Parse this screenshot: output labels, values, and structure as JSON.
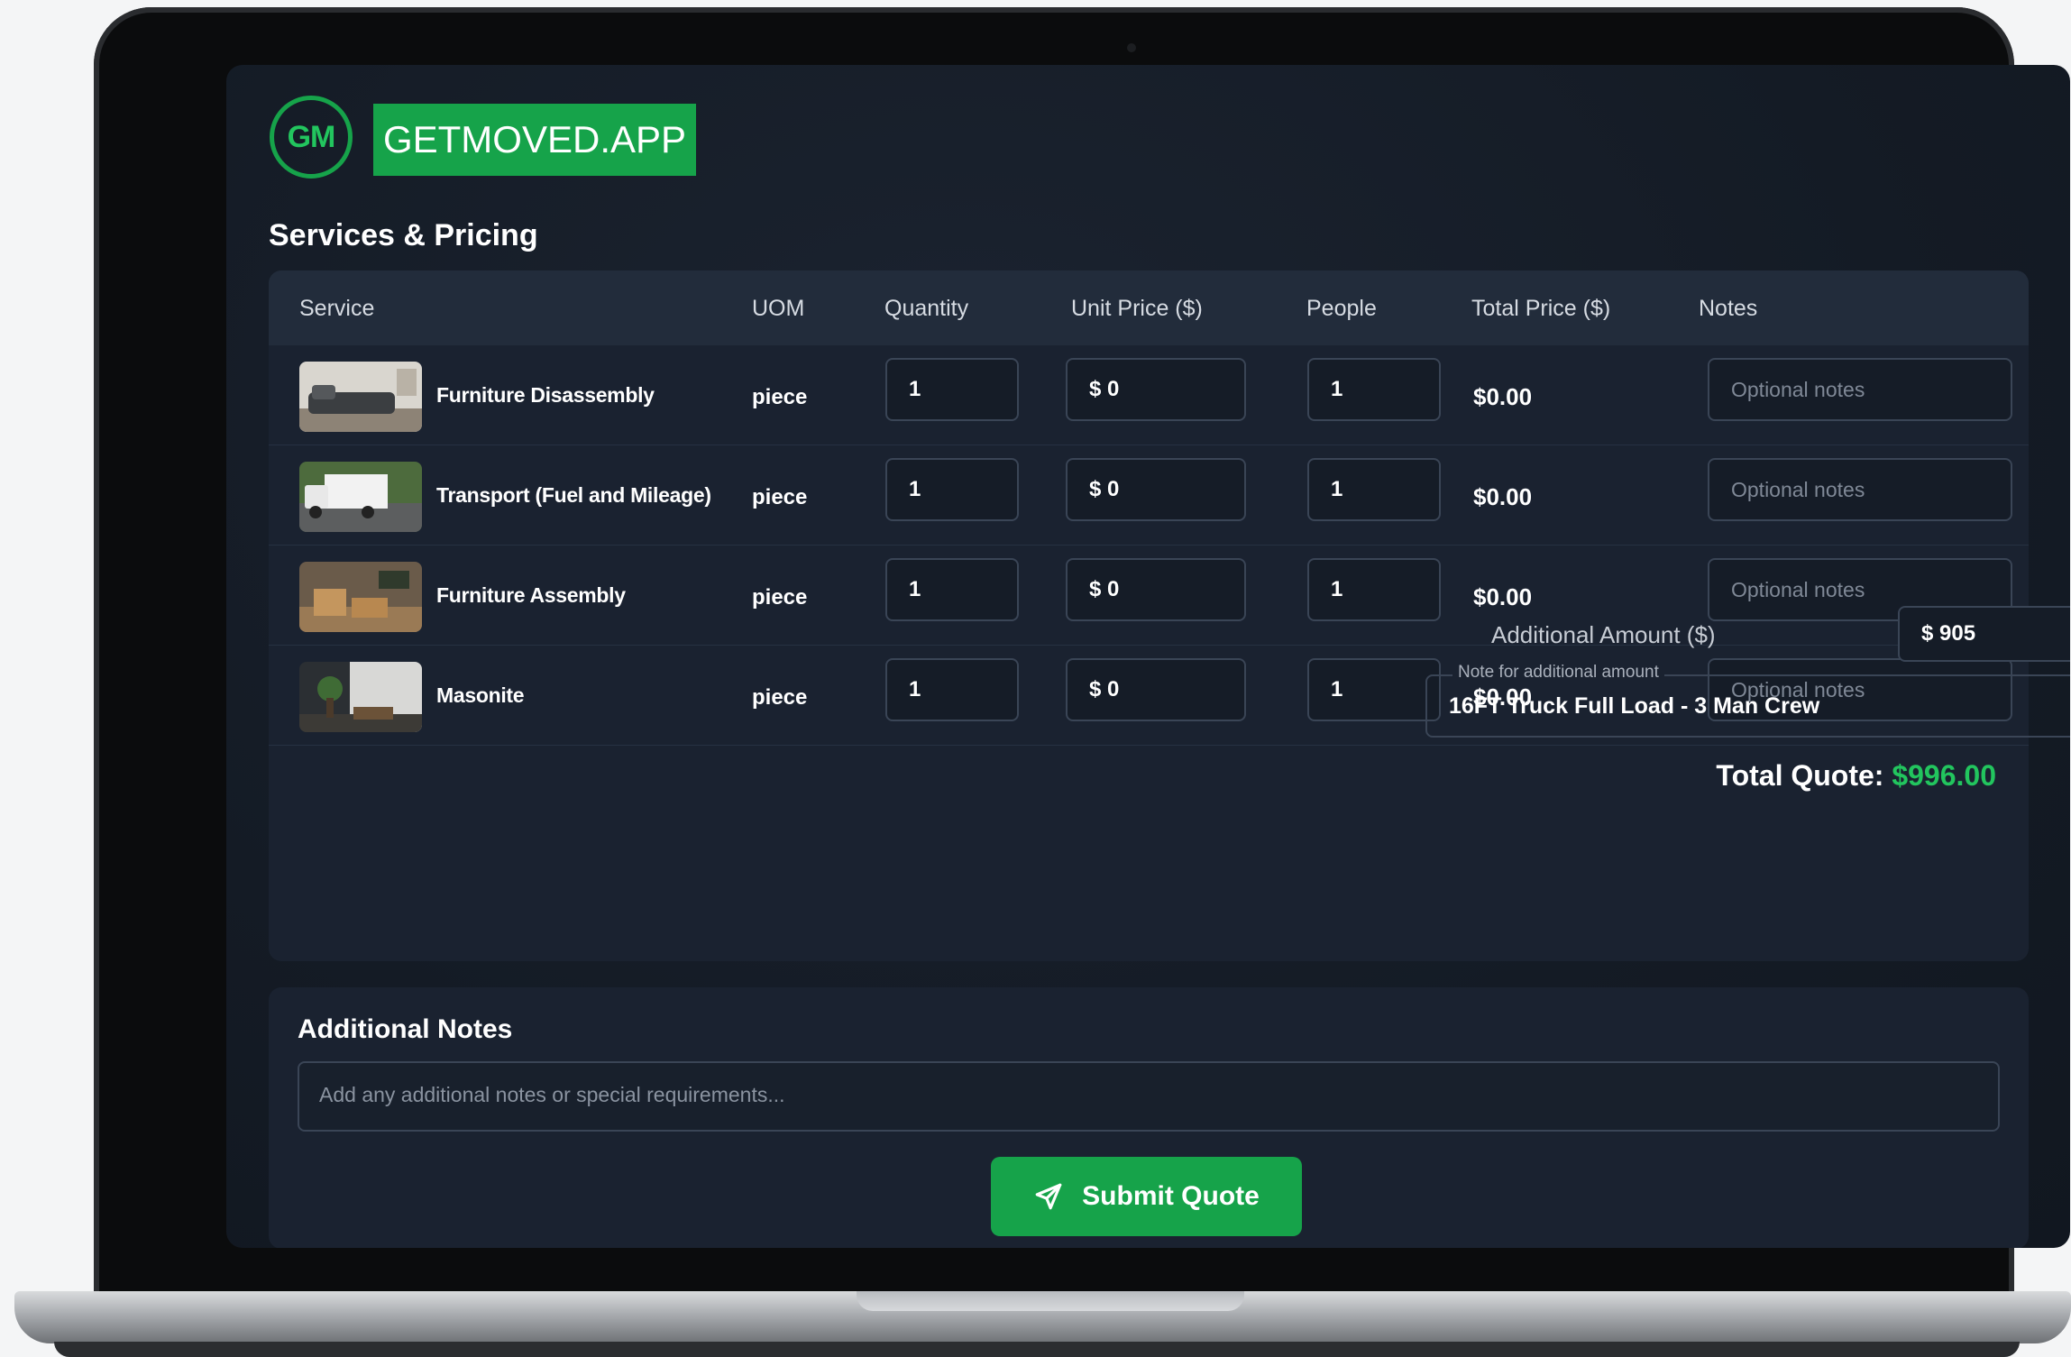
{
  "app": {
    "logo_text": "GM",
    "brand": "GETMOVED.APP"
  },
  "section_title": "Services & Pricing",
  "table": {
    "headers": [
      "Service",
      "UOM",
      "Quantity",
      "Unit Price ($)",
      "People",
      "Total Price ($)",
      "Notes"
    ],
    "rows": [
      {
        "service": "Furniture Disassembly",
        "uom": "piece",
        "quantity": "1",
        "unit_price": "$ 0",
        "people": "1",
        "total": "$0.00",
        "notes_placeholder": "Optional notes"
      },
      {
        "service": "Transport (Fuel and Mileage)",
        "uom": "piece",
        "quantity": "1",
        "unit_price": "$ 0",
        "people": "1",
        "total": "$0.00",
        "notes_placeholder": "Optional notes"
      },
      {
        "service": "Furniture Assembly",
        "uom": "piece",
        "quantity": "1",
        "unit_price": "$ 0",
        "people": "1",
        "total": "$0.00",
        "notes_placeholder": "Optional notes"
      },
      {
        "service": "Masonite",
        "uom": "piece",
        "quantity": "1",
        "unit_price": "$ 0",
        "people": "1",
        "total": "$0.00",
        "notes_placeholder": "Optional notes"
      }
    ]
  },
  "additional_amount": {
    "label": "Additional Amount ($)",
    "value": "$ 905",
    "note_label": "Note for additional amount",
    "note_value": "16FT Truck Full Load - 3 Man Crew"
  },
  "total_quote": {
    "label": "Total Quote:",
    "value": "$996.00"
  },
  "additional_notes": {
    "title": "Additional Notes",
    "placeholder": "Add any additional notes or special requirements..."
  },
  "submit": {
    "label": "Submit Quote",
    "icon": "send-icon"
  },
  "colors": {
    "accent": "#16a34a",
    "accent_text": "#22c55e",
    "background": "#141b25",
    "card": "#1a2230"
  }
}
